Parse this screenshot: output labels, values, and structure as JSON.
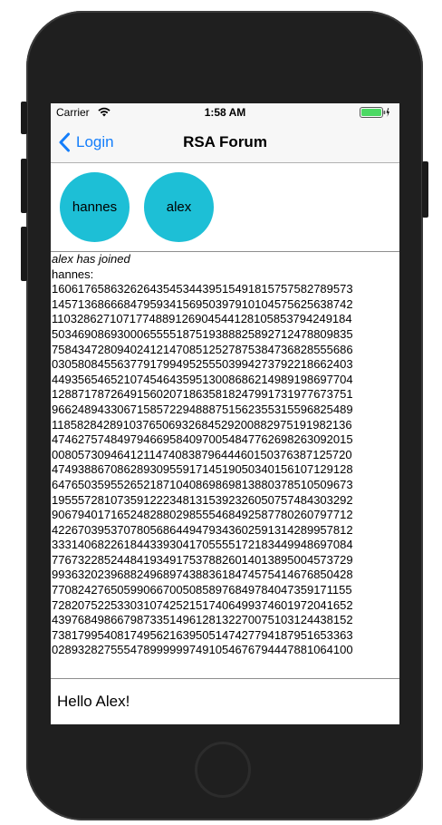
{
  "status_bar": {
    "carrier": "Carrier",
    "time": "1:58 AM"
  },
  "nav": {
    "back_label": "Login",
    "title": "RSA Forum"
  },
  "users": [
    "hannes",
    "alex"
  ],
  "chat": {
    "joined_message": "alex has joined",
    "sender": "hannes:",
    "number_lines": [
      "1606176586326264354534439515491815757582789573",
      "1457136866684795934156950397910104575625638742",
      "1103286271071774889126904544128105853794249184",
      "5034690869300065555187519388825892712478809835",
      "7584347280940241214708512527875384736828555686",
      "0305808455637791799495255503994273792218662403",
      "4493565465210745464359513008686214989198697704",
      "1288717872649156020718635818247991731977673751",
      "9662489433067158572294888751562355315596825489",
      "1185828428910376506932684529200882975191982136",
      "4746275748497946695840970054847762698263092015",
      "0080573094641211474083879644460150376387125720",
      "4749388670862893095591714519050340156107129128",
      "6476503595526521871040869869813880378510509673",
      "1955572810735912223481315392326050757484303292",
      "9067940171652482880298555468492587780260797712",
      "4226703953707805686449479343602591314289957812",
      "3331406822618443393041705555172183449948697084",
      "7767322852448419349175378826014013895004573729",
      "9936320239688249689743883618474575414676850428",
      "7708242765059906670050858976849784047359171155",
      "7282075225330310742521517406499374601972041652",
      "4397684986679873351496128132270075103124438152",
      "7381799540817495621639505147427794187951653363",
      "0289328275554789999997491054676794447881064100"
    ]
  },
  "message_input": {
    "value": "Hello Alex!"
  },
  "colors": {
    "accent": "#147efb",
    "user_bubble": "#1dbfd6"
  }
}
